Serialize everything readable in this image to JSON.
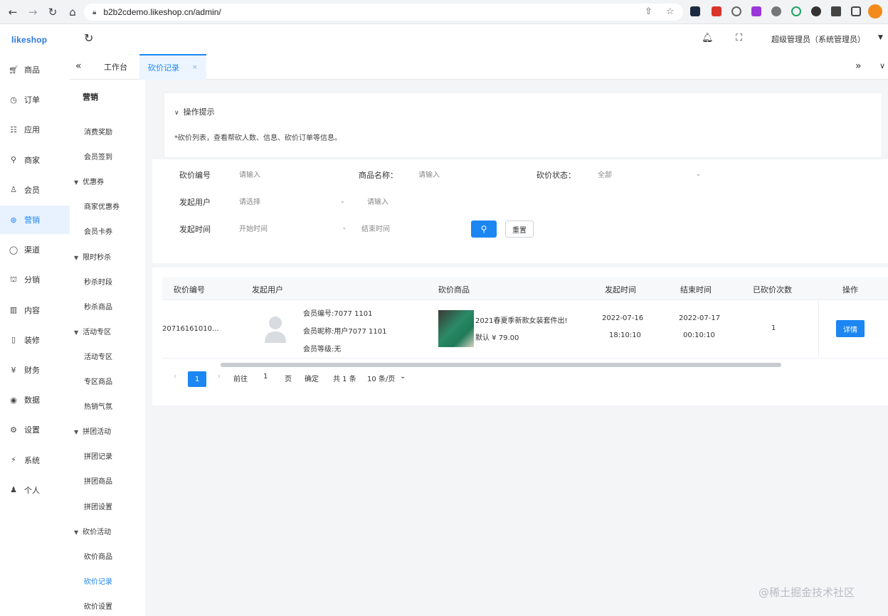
{
  "browser": {
    "url": "b2b2cdemo.likeshop.cn/admin/"
  },
  "header": {
    "logo": "likeshop",
    "username": "超级管理员（系统管理员）"
  },
  "primary_nav": [
    {
      "label": "商品",
      "icon": "cart-icon"
    },
    {
      "label": "订单",
      "icon": "order-icon"
    },
    {
      "label": "应用",
      "icon": "app-icon"
    },
    {
      "label": "商家",
      "icon": "shop-icon"
    },
    {
      "label": "会员",
      "icon": "user-icon"
    },
    {
      "label": "营销",
      "icon": "marketing-icon",
      "active": true
    },
    {
      "label": "渠道",
      "icon": "channel-icon"
    },
    {
      "label": "分销",
      "icon": "distribution-icon"
    },
    {
      "label": "内容",
      "icon": "content-icon"
    },
    {
      "label": "装修",
      "icon": "phone-icon"
    },
    {
      "label": "财务",
      "icon": "yen-icon"
    },
    {
      "label": "数据",
      "icon": "data-icon"
    },
    {
      "label": "设置",
      "icon": "settings-icon"
    },
    {
      "label": "系统",
      "icon": "system-icon"
    },
    {
      "label": "个人",
      "icon": "person-icon"
    }
  ],
  "secondary_nav": {
    "title": "营销",
    "items": [
      {
        "label": "消费奖励",
        "type": "item"
      },
      {
        "label": "会员签到",
        "type": "item"
      },
      {
        "label": "优惠券",
        "type": "group"
      },
      {
        "label": "商家优惠券",
        "type": "item"
      },
      {
        "label": "会员卡券",
        "type": "item"
      },
      {
        "label": "限时秒杀",
        "type": "group"
      },
      {
        "label": "秒杀时段",
        "type": "item"
      },
      {
        "label": "秒杀商品",
        "type": "item"
      },
      {
        "label": "活动专区",
        "type": "group"
      },
      {
        "label": "活动专区",
        "type": "item"
      },
      {
        "label": "专区商品",
        "type": "item"
      },
      {
        "label": "热销气氛",
        "type": "item"
      },
      {
        "label": "拼团活动",
        "type": "group"
      },
      {
        "label": "拼团记录",
        "type": "item"
      },
      {
        "label": "拼团商品",
        "type": "item"
      },
      {
        "label": "拼团设置",
        "type": "item"
      },
      {
        "label": "砍价活动",
        "type": "group"
      },
      {
        "label": "砍价商品",
        "type": "item"
      },
      {
        "label": "砍价记录",
        "type": "item",
        "active": true
      },
      {
        "label": "砍价设置",
        "type": "item"
      }
    ]
  },
  "tabs": [
    {
      "label": "工作台"
    },
    {
      "label": "砍价记录",
      "active": true,
      "close": "×"
    }
  ],
  "hint": {
    "title": "操作提示",
    "text": "*砍价列表，查看帮砍人数、信息、砍价订单等信息。"
  },
  "filter": {
    "bargain_no_label": "砍价编号",
    "bargain_no_placeholder": "请输入",
    "goods_name_label": "商品名称：",
    "goods_name_placeholder": "请输入",
    "status_label": "砍价状态：",
    "status_value": "全部",
    "initiator_label": "发起用户",
    "initiator_select": "请选择",
    "initiator_placeholder": "请输入",
    "time_label": "发起时间",
    "start_time": "开始时间",
    "time_sep": "-",
    "end_time": "结束时间",
    "reset_label": "重置"
  },
  "table": {
    "columns": [
      "砍价编号",
      "发起用户",
      "砍价商品",
      "发起时间",
      "结束时间",
      "已砍价次数",
      "操作"
    ],
    "rows": [
      {
        "bargain_no": "20716161010...",
        "user_no": "会员编号:7077 1101",
        "user_nick": "会员昵称:用户7077 1101",
        "user_level": "会员等级:无",
        "goods_name": "2021春夏季新款女装套件出!",
        "goods_price": "默认  ¥ 79.00",
        "start_date": "2022-07-16",
        "start_time": "18:10:10",
        "end_date": "2022-07-17",
        "end_time": "00:10:10",
        "count": "1",
        "action": "详情"
      }
    ]
  },
  "pagination": {
    "prev": "‹",
    "current": "1",
    "next": "›",
    "goto": "前往",
    "goto_value": "1",
    "page_unit": "页",
    "confirm": "确定",
    "total": "共 1 条",
    "page_size": "10 条/页"
  },
  "watermark": "@稀土掘金技术社区",
  "colors": {
    "primary": "#1c86f2",
    "active_bg": "#e8f2ff"
  }
}
